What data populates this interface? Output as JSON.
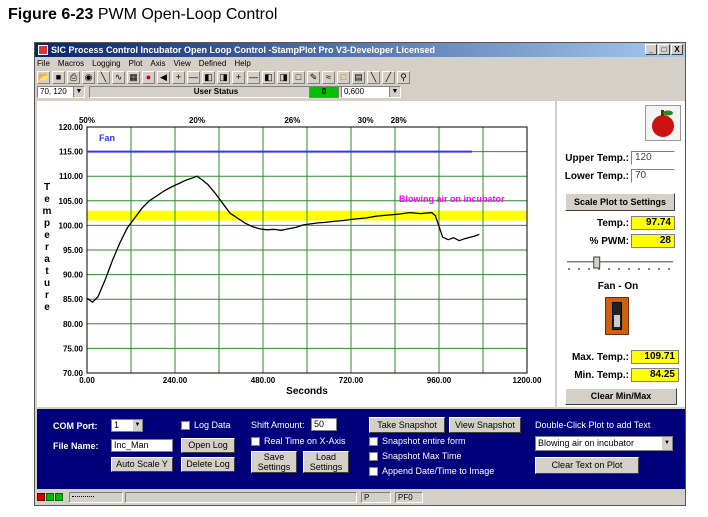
{
  "figure": {
    "number": "Figure 6-23",
    "title": "PWM Open-Loop Control"
  },
  "window": {
    "title": "SIC Process Control Incubator Open Loop Control -StampPlot Pro V3-Developer Licensed",
    "controls": [
      "_",
      "□",
      "X"
    ]
  },
  "menu": [
    "File",
    "Macros",
    "Logging",
    "Plot",
    "Axis",
    "View",
    "Defined",
    "Help"
  ],
  "toolbar_icons": [
    "open-icon",
    "save-icon",
    "print-icon",
    "camera-icon",
    "wand-icon",
    "plot-icon",
    "grid-icon",
    "stop-icon",
    "back-arrow-icon",
    "zoom-in-x-icon",
    "zoom-out-x-icon",
    "shift-left-icon",
    "shift-right-icon",
    "zoom-in-y-icon",
    "zoom-out-y-icon",
    "shift-down-icon",
    "shift-up-icon",
    "scale-icon",
    "pen-icon",
    "chart-icon",
    "folder-icon",
    "notes-icon",
    "line-icon",
    "brush-icon",
    "magnify-icon"
  ],
  "status_row": {
    "coord_combo": "70, 120",
    "user_status_label": "User Status",
    "green_value": "0",
    "message_combo": "0,600"
  },
  "chart_data": {
    "type": "line",
    "xlabel": "Seconds",
    "ylabel": "Temperature",
    "xlim": [
      0,
      1200
    ],
    "ylim": [
      70,
      120
    ],
    "xticks": [
      "0.00",
      "240.00",
      "480.00",
      "720.00",
      "960.00",
      "1200.00"
    ],
    "yticks": [
      "120.00",
      "115.00",
      "110.00",
      "105.00",
      "100.00",
      "95.00",
      "90.00",
      "85.00",
      "80.00",
      "75.00",
      "70.00"
    ],
    "grid": true,
    "band": {
      "from": 101,
      "to": 103,
      "color": "#ffff00"
    },
    "fan_line": {
      "label": "Fan",
      "y": 115,
      "x_end": 1050,
      "color": "#3333ff"
    },
    "annotation": {
      "text": "Blowing air on incubator",
      "x": 960,
      "y": 104.8,
      "color": "#ff00ff"
    },
    "pwm_labels": [
      {
        "x": 0,
        "text": "50%"
      },
      {
        "x": 300,
        "text": "20%"
      },
      {
        "x": 560,
        "text": "26%"
      },
      {
        "x": 760,
        "text": "30%"
      },
      {
        "x": 850,
        "text": "28%"
      }
    ],
    "series": [
      {
        "color": "#000000",
        "points": [
          [
            0,
            85.2
          ],
          [
            15,
            84.4
          ],
          [
            30,
            85.5
          ],
          [
            50,
            89
          ],
          [
            70,
            93
          ],
          [
            90,
            96.5
          ],
          [
            110,
            99.5
          ],
          [
            130,
            101.5
          ],
          [
            150,
            103.5
          ],
          [
            170,
            105
          ],
          [
            190,
            106
          ],
          [
            210,
            107
          ],
          [
            230,
            107.8
          ],
          [
            250,
            108.5
          ],
          [
            270,
            109.2
          ],
          [
            290,
            109.7
          ],
          [
            300,
            110
          ],
          [
            315,
            109.2
          ],
          [
            330,
            108.3
          ],
          [
            350,
            106.5
          ],
          [
            370,
            104.5
          ],
          [
            390,
            102.5
          ],
          [
            410,
            101.5
          ],
          [
            430,
            100.5
          ],
          [
            450,
            99.8
          ],
          [
            470,
            99.3
          ],
          [
            490,
            99.1
          ],
          [
            510,
            99.2
          ],
          [
            530,
            99.0
          ],
          [
            550,
            99.3
          ],
          [
            570,
            99.6
          ],
          [
            590,
            100.1
          ],
          [
            610,
            100.3
          ],
          [
            630,
            100.5
          ],
          [
            650,
            100.6
          ],
          [
            670,
            100.8
          ],
          [
            700,
            101.0
          ],
          [
            730,
            101.3
          ],
          [
            760,
            101.5
          ],
          [
            790,
            101.9
          ],
          [
            820,
            102.1
          ],
          [
            850,
            102.3
          ],
          [
            880,
            102.6
          ],
          [
            910,
            102.4
          ],
          [
            940,
            102.6
          ],
          [
            950,
            102.0
          ],
          [
            970,
            97.6
          ],
          [
            985,
            97.1
          ],
          [
            1000,
            97.5
          ],
          [
            1015,
            96.9
          ],
          [
            1030,
            97.3
          ],
          [
            1045,
            97.6
          ],
          [
            1060,
            97.9
          ],
          [
            1070,
            98.2
          ]
        ]
      }
    ]
  },
  "right_panel": {
    "upper_temp_label": "Upper Temp.:",
    "upper_temp_value": "120",
    "lower_temp_label": "Lower Temp.:",
    "lower_temp_value": "70",
    "scale_button": "Scale Plot to Settings",
    "temp_label": "Temp.:",
    "temp_value": "97.74",
    "pwm_label": "% PWM:",
    "pwm_value": "28",
    "fan_label": "Fan - On",
    "max_temp_label": "Max. Temp.:",
    "max_temp_value": "109.71",
    "min_temp_label": "Min. Temp.:",
    "min_temp_value": "84.25",
    "clear_minmax_button": "Clear Min/Max"
  },
  "bottom_panel": {
    "com_port_label": "COM Port:",
    "com_port_value": "1",
    "file_name_label": "File Name:",
    "file_name_value": "Inc_Man",
    "auto_scale_button": "Auto Scale Y",
    "log_data_label": "Log Data",
    "open_log_button": "Open Log",
    "delete_log_button": "Delete Log",
    "shift_amount_label": "Shift Amount:",
    "shift_amount_value": "50",
    "realtime_label": "Real Time on X-Axis",
    "save_settings_button": [
      "Save",
      "Settings"
    ],
    "load_settings_button": [
      "Load",
      "Settings"
    ],
    "take_snapshot_button": "Take Snapshot",
    "view_snapshot_button": "View Snapshot",
    "snapshot_entire_label": "Snapshot entire form",
    "snapshot_max_label": "Snapshot Max Time",
    "append_date_label": "Append Date/Time to Image",
    "double_click_label": "Double-Click Plot to add Text",
    "text_combo_value": "Blowing air on incubator",
    "clear_text_button": "Clear Text on Plot"
  },
  "statusbar": {
    "seg1": "",
    "seg2": "P",
    "seg3": "PF0"
  }
}
